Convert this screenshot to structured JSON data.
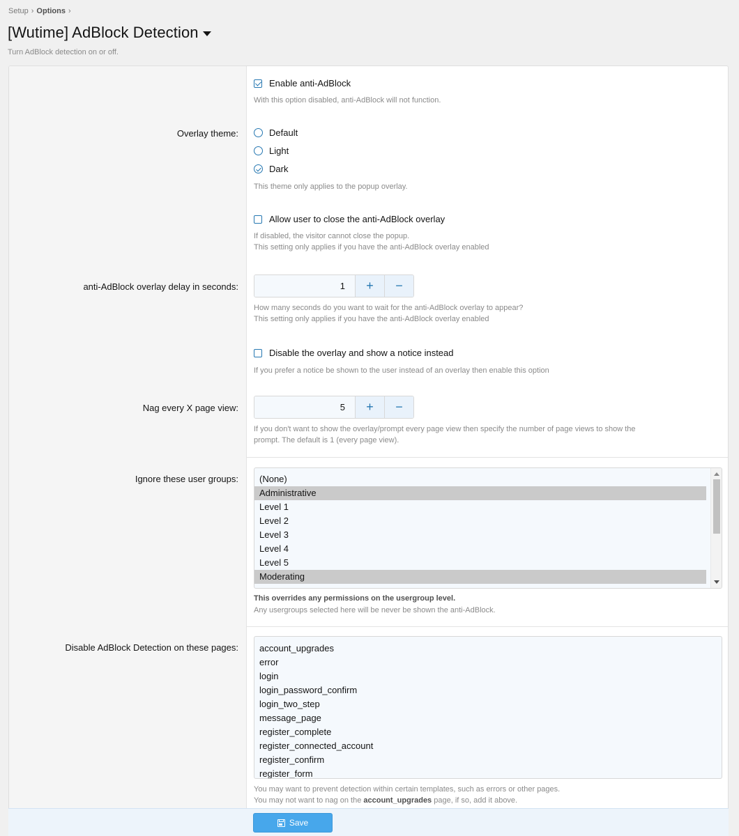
{
  "breadcrumb": {
    "setup": "Setup",
    "options": "Options",
    "sep": "›"
  },
  "page": {
    "title": "[Wutime] AdBlock Detection",
    "description": "Turn AdBlock detection on or off."
  },
  "options": {
    "enable": {
      "label": "Enable anti-AdBlock",
      "checked": true,
      "hint": "With this option disabled, anti-AdBlock will not function."
    },
    "overlay_theme": {
      "row_label": "Overlay theme:",
      "choices": [
        {
          "label": "Default",
          "checked": false
        },
        {
          "label": "Light",
          "checked": false
        },
        {
          "label": "Dark",
          "checked": true
        }
      ],
      "hint": "This theme only applies to the popup overlay."
    },
    "allow_close": {
      "label": "Allow user to close the anti-AdBlock overlay",
      "checked": false,
      "hint1": "If disabled, the visitor cannot close the popup.",
      "hint2": "This setting only applies if you have the anti-AdBlock overlay enabled"
    },
    "delay": {
      "row_label": "anti-AdBlock overlay delay in seconds:",
      "value": "1",
      "plus": "+",
      "minus": "−",
      "hint1": "How many seconds do you want to wait for the anti-AdBlock overlay to appear?",
      "hint2": "This setting only applies if you have the anti-AdBlock overlay enabled"
    },
    "notice": {
      "label": "Disable the overlay and show a notice instead",
      "checked": false,
      "hint": "If you prefer a notice be shown to the user instead of an overlay then enable this option"
    },
    "nag": {
      "row_label": "Nag every X page view:",
      "value": "5",
      "plus": "+",
      "minus": "−",
      "hint1": "If you don't want to show the overlay/prompt every page view then specify the number of page views to show the",
      "hint2": "prompt. The default is 1 (every page view)."
    },
    "ignore_groups": {
      "row_label": "Ignore these user groups:",
      "items": [
        {
          "label": "(None)",
          "selected": false
        },
        {
          "label": "Administrative",
          "selected": true
        },
        {
          "label": "Level 1",
          "selected": false
        },
        {
          "label": "Level 2",
          "selected": false
        },
        {
          "label": "Level 3",
          "selected": false
        },
        {
          "label": "Level 4",
          "selected": false
        },
        {
          "label": "Level 5",
          "selected": false
        },
        {
          "label": "Moderating",
          "selected": true
        }
      ],
      "hint_strong": "This overrides any permissions on the usergroup level.",
      "hint": "Any usergroups selected here will be never be shown the anti-AdBlock."
    },
    "disable_pages": {
      "row_label": "Disable AdBlock Detection on these pages:",
      "lines": [
        "account_upgrades",
        "error",
        "login",
        "login_password_confirm",
        "login_two_step",
        "message_page",
        "register_complete",
        "register_connected_account",
        "register_confirm",
        "register_form"
      ],
      "hint1": "You may want to prevent detection within certain templates, such as errors or other pages.",
      "hint2_pre": "You may not want to nag on the ",
      "hint2_strong": "account_upgrades",
      "hint2_post": " page, if so, add it above."
    }
  },
  "footer": {
    "save_label": "Save"
  },
  "colors": {
    "accent": "#2577b1",
    "button": "#47a7eb",
    "selection": "#cacaca"
  },
  "icons": {
    "title_dropdown": "caret-down-icon",
    "save": "floppy-disk-icon"
  }
}
